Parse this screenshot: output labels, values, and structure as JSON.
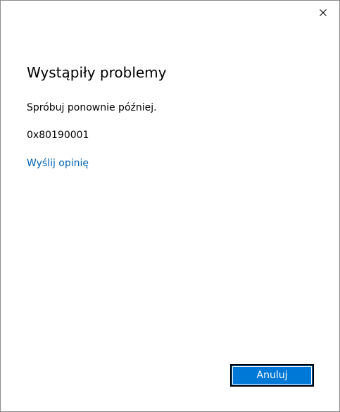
{
  "dialog": {
    "title": "Wystąpiły problemy",
    "message": "Spróbuj ponownie później.",
    "error_code": "0x80190001",
    "feedback_link": "Wyślij opinię",
    "cancel_label": "Anuluj",
    "close_icon": "close-icon"
  },
  "colors": {
    "accent": "#0078d7",
    "link": "#0063b1",
    "background": "#ffffff",
    "text": "#000000"
  }
}
